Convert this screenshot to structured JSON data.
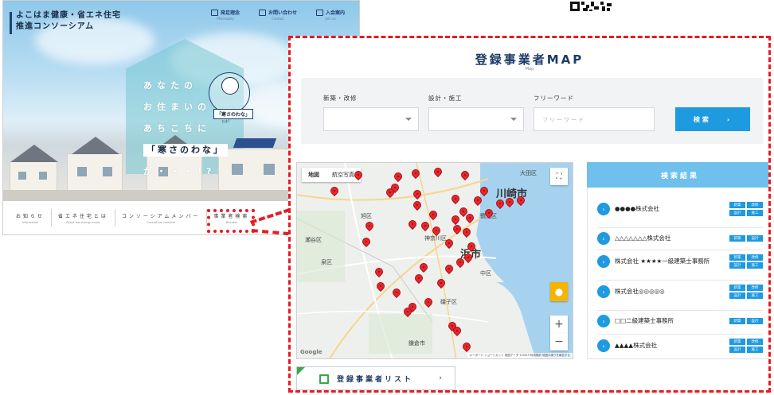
{
  "site": {
    "logo_line1": "よこはま健康・省エネ住宅",
    "logo_line2": "推進コンソーシアム",
    "top_nav": [
      {
        "label": "発足理念",
        "sub": "Philosophy",
        "icon": "house-icon"
      },
      {
        "label": "お問い合わせ",
        "sub": "Contact",
        "icon": "mail-icon"
      },
      {
        "label": "入会案内",
        "sub": "Join us",
        "icon": "document-icon"
      }
    ],
    "catch_lines": [
      "あなたの",
      "お住まいの",
      "あちこちに"
    ],
    "catch_highlight": "「寒さのわな」",
    "catch_end": "が・・・!?",
    "badge": "「寒さのわな」",
    "badge_sub": "とは?",
    "bottom_nav": [
      {
        "label": "お知らせ",
        "sub": "Information"
      },
      {
        "label": "省エネ住宅とは",
        "sub": "About low-energy house"
      },
      {
        "label": "コンソーシアムメンバー",
        "sub": "Consortium member"
      },
      {
        "label": "事業者検索",
        "sub": "Builders"
      }
    ]
  },
  "map_section": {
    "title": "登録事業者MAP",
    "subtitle": "Map",
    "filters": {
      "type_label": "新築・改修",
      "work_label": "設計・施工",
      "freeword_label": "フリーワード",
      "freeword_placeholder": "フリーワード",
      "search_button": "検索"
    },
    "map": {
      "tab_map": "地図",
      "tab_satellite": "航空写真",
      "label_ota": "大田区",
      "label_kawasaki": "川崎市",
      "label_city": "浜市",
      "label_tsurumi": "鶴見区",
      "label_kanagawa": "神奈川区",
      "label_asahi": "旭区",
      "label_seya": "瀬谷区",
      "label_izumi": "泉区",
      "label_naka": "中区",
      "label_isogo": "磯子区",
      "label_kamakura": "鎌倉市",
      "footer": "キーボード ショートカット 地図データ ©2023 利用規約 地図の誤りを報告する",
      "google": "Google"
    },
    "results": {
      "header": "検索結果",
      "items": [
        {
          "name": "●●●●株式会社",
          "tags": [
            "新築",
            "改修",
            "設計",
            "施工"
          ]
        },
        {
          "name": "△△△△△△△株式会社",
          "tags": [
            "新築",
            "設計"
          ]
        },
        {
          "name": "株式会社 ★★★★一級建築士事務所",
          "tags": [
            "新築",
            "改修",
            "設計",
            "施工"
          ]
        },
        {
          "name": "株式会社◎◎◎◎◎",
          "tags": [
            "新築",
            "改修",
            "設計",
            "施工"
          ]
        },
        {
          "name": "□□二級建築士事務所",
          "tags": [
            "新築",
            "設計"
          ]
        },
        {
          "name": "▲▲▲▲株式会社",
          "tags": [
            "新築",
            "改修",
            "設計",
            "施工"
          ]
        }
      ]
    },
    "list_button": "登録事業者リスト"
  },
  "colors": {
    "highlight_red": "#e51c23",
    "accent_blue": "#1e9ae0",
    "header_blue": "#6fc0ec",
    "title_navy": "#1d3a66"
  }
}
